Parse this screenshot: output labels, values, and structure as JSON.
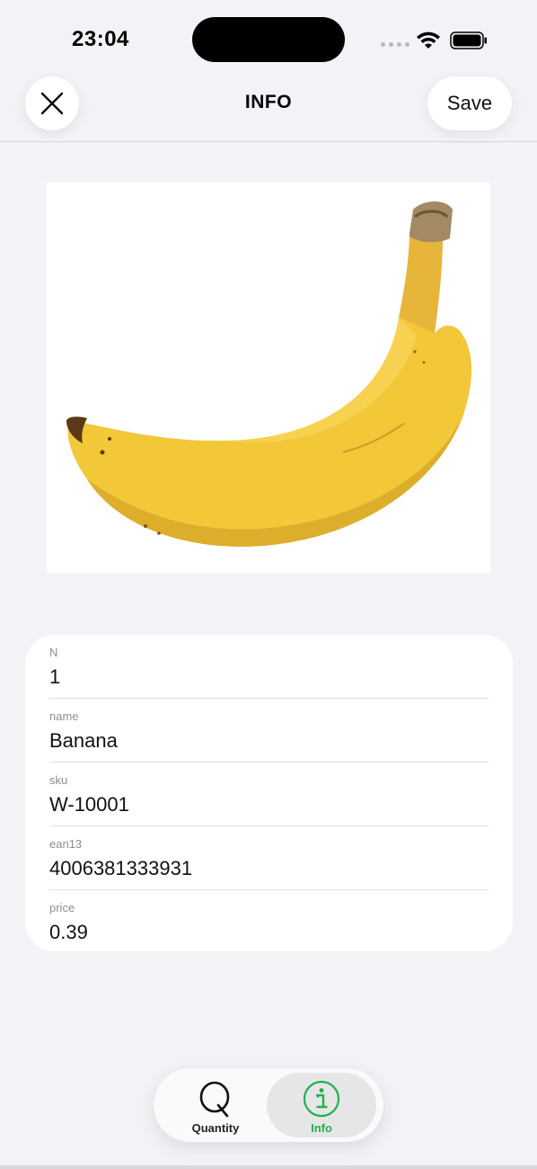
{
  "status_bar": {
    "time": "23:04"
  },
  "nav": {
    "title": "INFO",
    "save_label": "Save",
    "close_icon": "close-icon"
  },
  "product": {
    "image_subject": "banana-image"
  },
  "fields": [
    {
      "label": "N",
      "value": "1"
    },
    {
      "label": "name",
      "value": "Banana"
    },
    {
      "label": "sku",
      "value": "W-10001"
    },
    {
      "label": "ean13",
      "value": "4006381333931"
    },
    {
      "label": "price",
      "value": "0.39"
    }
  ],
  "tabs": [
    {
      "label": "Quantity",
      "icon": "quantity-icon",
      "selected": false
    },
    {
      "label": "Info",
      "icon": "info-icon",
      "selected": true
    }
  ],
  "colors": {
    "background": "#f2f2f7",
    "accent_green": "#22b14c",
    "card": "#ffffff"
  }
}
